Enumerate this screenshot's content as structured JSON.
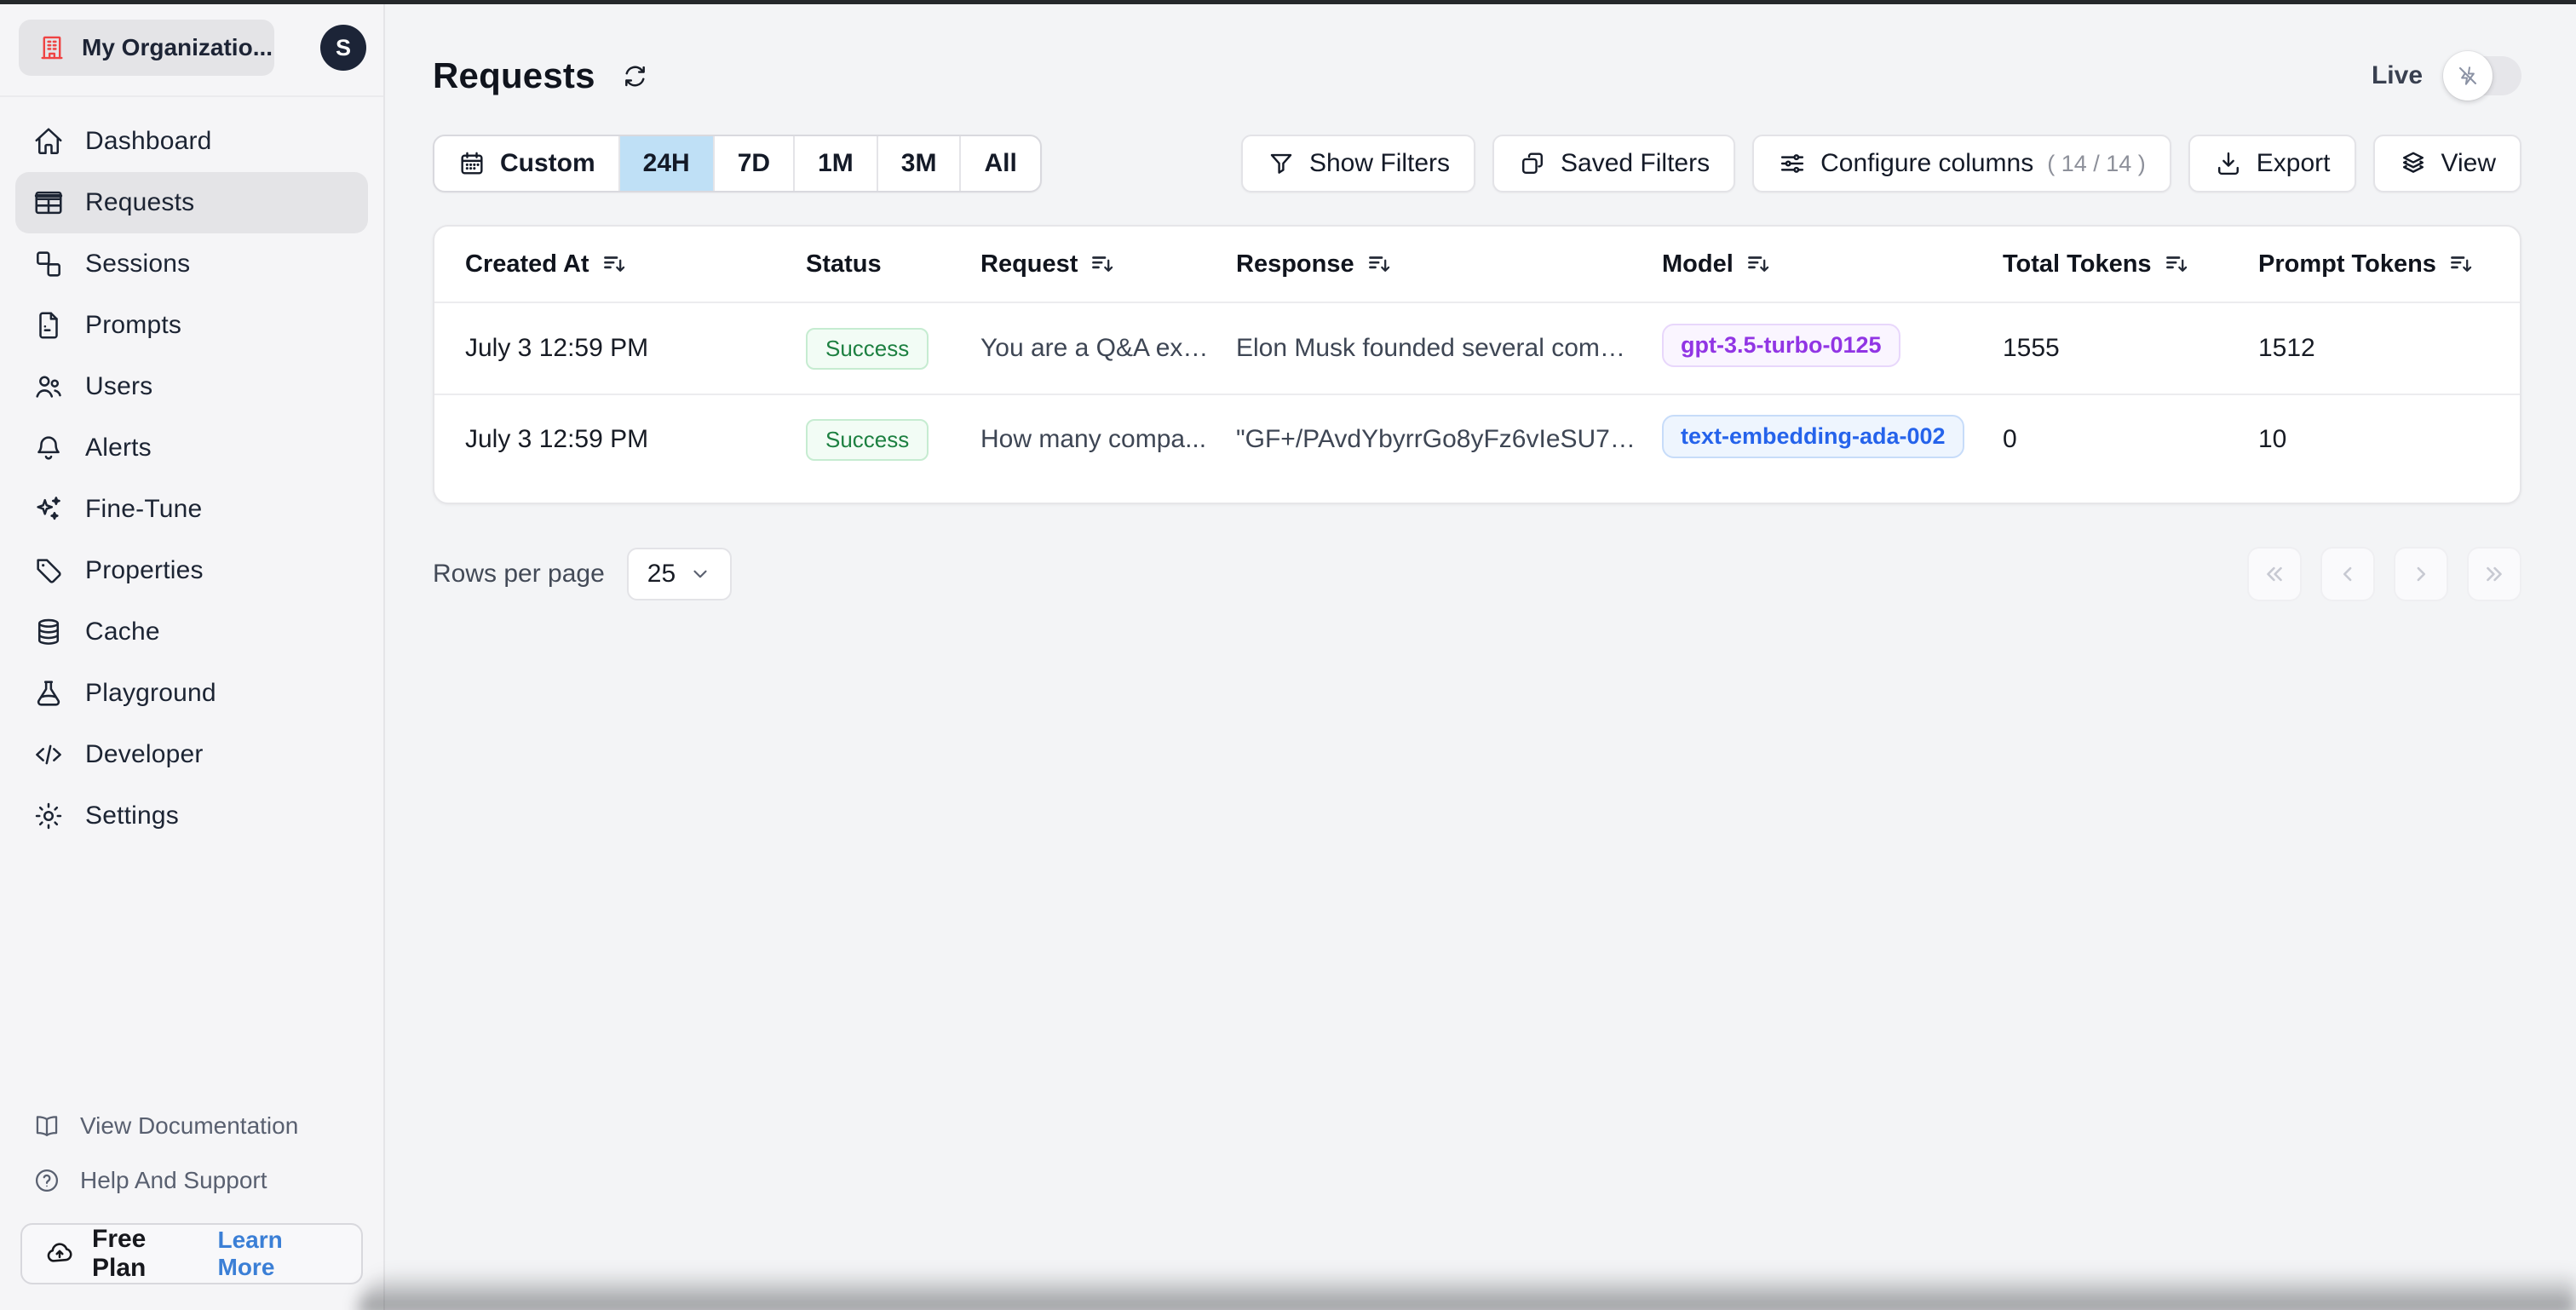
{
  "sidebar": {
    "org": {
      "name": "My Organizatio...",
      "initial": "S"
    },
    "nav": [
      {
        "label": "Dashboard",
        "icon": "home-icon",
        "active": false
      },
      {
        "label": "Requests",
        "icon": "table-icon",
        "active": true
      },
      {
        "label": "Sessions",
        "icon": "sessions-icon",
        "active": false
      },
      {
        "label": "Prompts",
        "icon": "document-icon",
        "active": false
      },
      {
        "label": "Users",
        "icon": "users-icon",
        "active": false
      },
      {
        "label": "Alerts",
        "icon": "bell-icon",
        "active": false
      },
      {
        "label": "Fine-Tune",
        "icon": "sparkles-icon",
        "active": false
      },
      {
        "label": "Properties",
        "icon": "tag-icon",
        "active": false
      },
      {
        "label": "Cache",
        "icon": "database-icon",
        "active": false
      },
      {
        "label": "Playground",
        "icon": "beaker-icon",
        "active": false
      },
      {
        "label": "Developer",
        "icon": "code-icon",
        "active": false
      },
      {
        "label": "Settings",
        "icon": "gear-icon",
        "active": false
      }
    ],
    "footer_links": [
      {
        "label": "View Documentation",
        "icon": "book-icon"
      },
      {
        "label": "Help And Support",
        "icon": "help-icon"
      }
    ],
    "plan": {
      "label": "Free Plan",
      "cta": "Learn More",
      "icon": "cloud-up-icon"
    }
  },
  "header": {
    "title": "Requests",
    "live_label": "Live",
    "live_on": false
  },
  "toolbar": {
    "time_ranges": [
      {
        "label": "Custom",
        "icon": "calendar-icon",
        "selected": false
      },
      {
        "label": "24H",
        "selected": true
      },
      {
        "label": "7D",
        "selected": false
      },
      {
        "label": "1M",
        "selected": false
      },
      {
        "label": "3M",
        "selected": false
      },
      {
        "label": "All",
        "selected": false
      }
    ],
    "buttons": [
      {
        "label": "Show Filters",
        "icon": "funnel-icon"
      },
      {
        "label": "Saved Filters",
        "icon": "copy-icon"
      },
      {
        "label": "Configure columns",
        "icon": "sliders-icon",
        "suffix": "( 14 / 14 )"
      },
      {
        "label": "Export",
        "icon": "download-icon"
      },
      {
        "label": "View",
        "icon": "layers-icon"
      }
    ]
  },
  "table": {
    "columns": [
      {
        "label": "Created At",
        "sortable": true
      },
      {
        "label": "Status",
        "sortable": false
      },
      {
        "label": "Request",
        "sortable": true
      },
      {
        "label": "Response",
        "sortable": true
      },
      {
        "label": "Model",
        "sortable": true
      },
      {
        "label": "Total Tokens",
        "sortable": true
      },
      {
        "label": "Prompt Tokens",
        "sortable": true
      }
    ],
    "rows": [
      {
        "created_at": "July 3 12:59 PM",
        "status": "Success",
        "request": "You are a Q&A exp...",
        "response": "Elon Musk founded several compa...",
        "model": "gpt-3.5-turbo-0125",
        "model_color": "purple",
        "total_tokens": "1555",
        "prompt_tokens": "1512"
      },
      {
        "created_at": "July 3 12:59 PM",
        "status": "Success",
        "request": "How many compa...",
        "response": "\"GF+/PAvdYbyrrGo8yFz6vIeSU7w...",
        "model": "text-embedding-ada-002",
        "model_color": "blue",
        "total_tokens": "0",
        "prompt_tokens": "10"
      }
    ]
  },
  "pagination": {
    "rows_label": "Rows per page",
    "page_size": "25"
  },
  "colors": {
    "accent_selected_range": "#bfe0f6",
    "success_text": "#1d8041",
    "model_purple": "#9135e4",
    "model_blue": "#2563eb",
    "org_icon_red": "#ef4444",
    "learn_more_blue": "#3b7fd6"
  }
}
